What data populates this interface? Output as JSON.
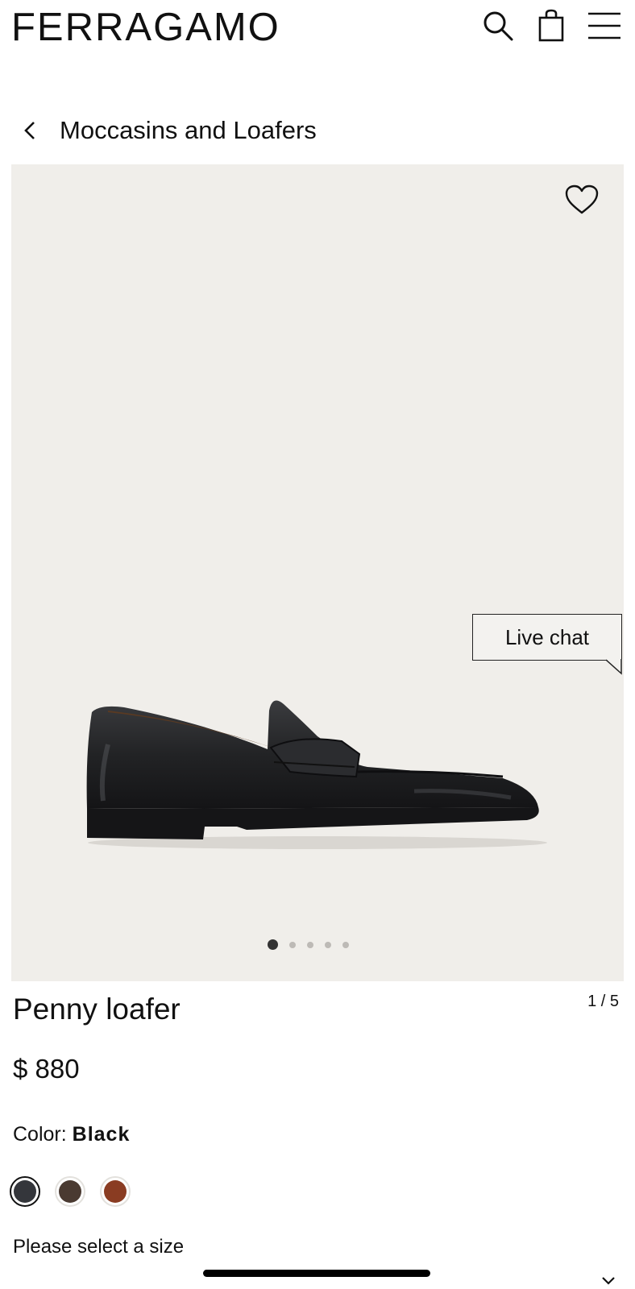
{
  "header": {
    "logo": "FERRAGAMO",
    "icons": [
      "search-icon",
      "shopping-bag-icon",
      "menu-icon"
    ]
  },
  "breadcrumb": {
    "back_icon": "chevron-left-icon",
    "label": "Moccasins and Loafers"
  },
  "gallery": {
    "background": "#f0eeea",
    "image_count": 5,
    "active_index": 1,
    "counter": "1 / 5",
    "wishlist_icon": "heart-outline-icon"
  },
  "live_chat": {
    "label": "Live chat"
  },
  "product": {
    "title": "Penny loafer",
    "price": "$ 880",
    "color_label": "Color:",
    "color_value": "Black",
    "swatches": [
      {
        "name": "black",
        "color": "#34363b",
        "selected": true
      },
      {
        "name": "brown",
        "color": "#4a3a31",
        "selected": false
      },
      {
        "name": "cognac",
        "color": "#8a3c22",
        "selected": false
      }
    ],
    "size_prompt": "Please select a size",
    "size_icon": "chevron-down-icon"
  }
}
